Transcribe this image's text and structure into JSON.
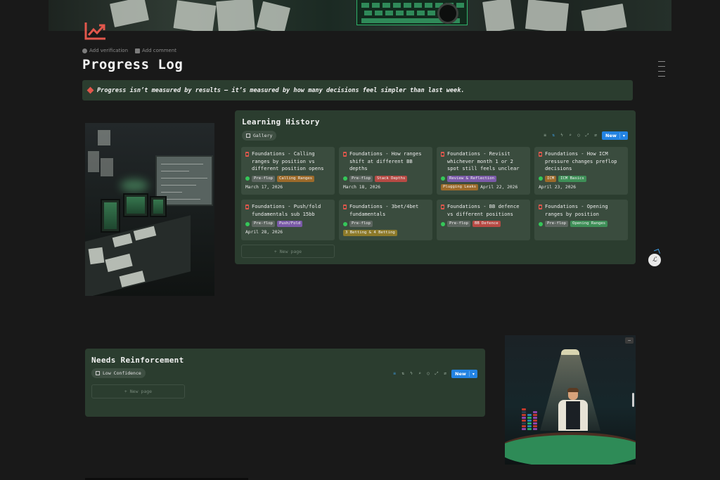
{
  "page": {
    "title": "Progress Log",
    "add_verification": "Add verification",
    "add_comment": "Add comment"
  },
  "callout": {
    "text": "Progress isn’t measured by results — it’s measured by how many decisions feel simpler than last week.",
    "icon": "red-diamond-icon"
  },
  "learning_history": {
    "title": "Learning History",
    "view": "Gallery",
    "new_label": "New",
    "new_page": "+ New page",
    "cards": [
      {
        "title": "Foundations - Calling ranges by position vs different position opens",
        "tags": [
          {
            "label": "Pre-flop",
            "color": "gray"
          },
          {
            "label": "Calling Ranges",
            "color": "orange"
          }
        ],
        "date": "March 17, 2026"
      },
      {
        "title": "Foundations - How ranges shift at different BB depths",
        "tags": [
          {
            "label": "Pre-flop",
            "color": "gray"
          },
          {
            "label": "Stack Depths",
            "color": "red"
          }
        ],
        "date": "March 18, 2026"
      },
      {
        "title": "Foundations - Revisit whichever month 1 or 2 spot still feels unclear",
        "tags": [
          {
            "label": "Review & Reflection",
            "color": "purple"
          },
          {
            "label": "Plugging Leaks",
            "color": "orange"
          }
        ],
        "date": "April 22, 2026"
      },
      {
        "title": "Foundations - How ICM pressure changes preflop decisions",
        "tags": [
          {
            "label": "ICM",
            "color": "orange"
          },
          {
            "label": "ICM Basics",
            "color": "green"
          }
        ],
        "date": "April 23, 2026"
      },
      {
        "title": "Foundations - Push/fold fundamentals sub 15bb",
        "tags": [
          {
            "label": "Pre-flop",
            "color": "gray"
          },
          {
            "label": "Push/Fold",
            "color": "purple"
          }
        ],
        "date": "April 28, 2026"
      },
      {
        "title": "Foundations - 3bet/4bet fundamentals",
        "tags": [
          {
            "label": "Pre-flop",
            "color": "gray"
          },
          {
            "label": "3 Betting & 4 Betting",
            "color": "yellow"
          }
        ],
        "date": ""
      },
      {
        "title": "Foundations - BB defence vs different positions",
        "tags": [
          {
            "label": "Pre-flop",
            "color": "gray"
          },
          {
            "label": "BB Defence",
            "color": "red"
          }
        ],
        "date": ""
      },
      {
        "title": "Foundations - Opening ranges by position",
        "tags": [
          {
            "label": "Pre-flop",
            "color": "gray"
          },
          {
            "label": "Opening Ranges",
            "color": "green"
          }
        ],
        "date": ""
      }
    ]
  },
  "needs_reinforcement": {
    "title": "Needs Reinforcement",
    "view": "Low Confidence",
    "new_label": "New",
    "new_page": "+ New page"
  },
  "colors": {
    "page_bg": "#191919",
    "panel_bg": "#2b3d2f",
    "card_bg": "#3a4c3e",
    "accent_blue": "#2383e2",
    "accent_red": "#e2574c"
  }
}
